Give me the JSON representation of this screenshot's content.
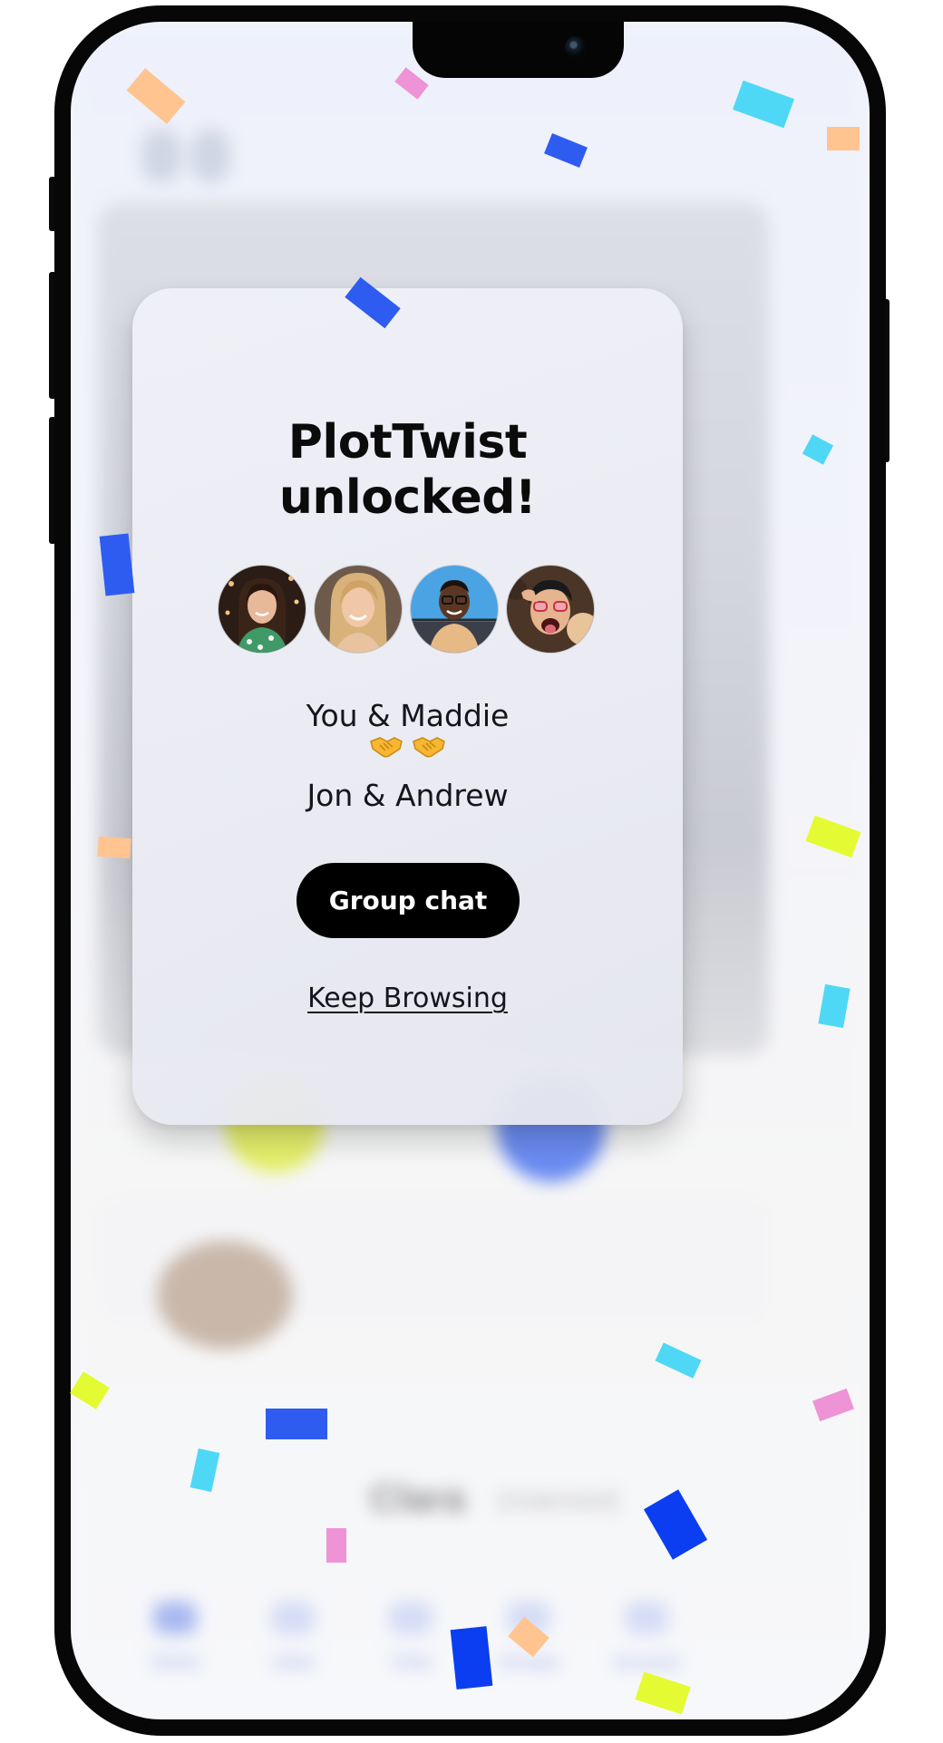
{
  "modal": {
    "title_line1": "PlotTwist",
    "title_line2": "unlocked!",
    "pair_you": "You & Maddie",
    "pair_them": "Jon & Andrew",
    "primary_button": "Group chat",
    "secondary_link": "Keep Browsing"
  },
  "avatars": [
    {
      "name": "avatar-1",
      "icon": "woman-dark-hair-photo"
    },
    {
      "name": "avatar-2",
      "icon": "woman-blonde-photo"
    },
    {
      "name": "avatar-3",
      "icon": "man-glasses-photo"
    },
    {
      "name": "avatar-4",
      "icon": "man-sunglasses-photo"
    }
  ],
  "icons": {
    "handshake": "handshake-icon"
  },
  "colors": {
    "button_bg": "#000000",
    "button_text": "#ffffff",
    "confetti_blue": "#2f5cf0",
    "confetti_cyan": "#4fd8f5",
    "confetti_yellow": "#e4fb33",
    "confetti_orange": "#ffc490",
    "confetti_pink": "#ee93d6"
  }
}
